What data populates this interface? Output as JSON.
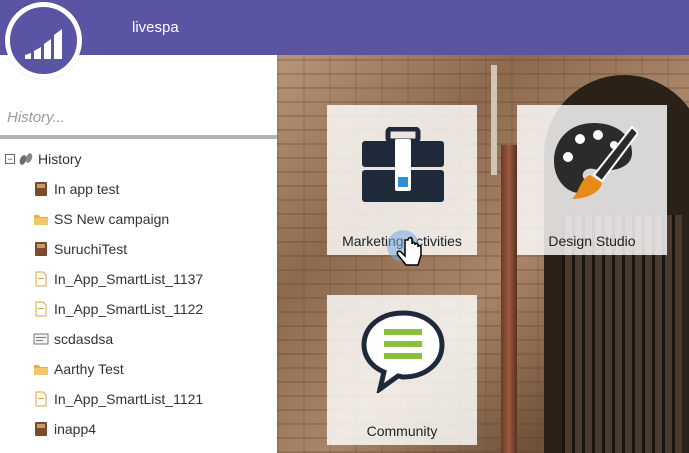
{
  "header": {
    "workspace_name": "livespa",
    "logo_icon": "marketo-bars-logo",
    "background_color": "#5a54a4"
  },
  "sidebar": {
    "search_placeholder": "History...",
    "tree": {
      "root_label": "History",
      "root_icon": "history-footprints-icon",
      "items": [
        {
          "label": "In app test",
          "icon": "program-book-icon"
        },
        {
          "label": "SS New campaign",
          "icon": "campaign-folder-icon"
        },
        {
          "label": "SuruchiTest",
          "icon": "program-book-icon"
        },
        {
          "label": "In_App_SmartList_1137",
          "icon": "smartlist-page-icon"
        },
        {
          "label": "In_App_SmartList_1122",
          "icon": "smartlist-page-icon"
        },
        {
          "label": "scdasdsa",
          "icon": "email-template-icon"
        },
        {
          "label": "Aarthy Test",
          "icon": "campaign-folder-icon"
        },
        {
          "label": "In_App_SmartList_1121",
          "icon": "smartlist-page-icon"
        },
        {
          "label": "inapp4",
          "icon": "program-book-icon"
        }
      ]
    }
  },
  "tiles": [
    {
      "label": "Marketing Activities",
      "icon": "briefcase-icon"
    },
    {
      "label": "Design Studio",
      "icon": "paint-palette-icon"
    },
    {
      "label": "Community",
      "icon": "speech-bubble-icon"
    }
  ]
}
